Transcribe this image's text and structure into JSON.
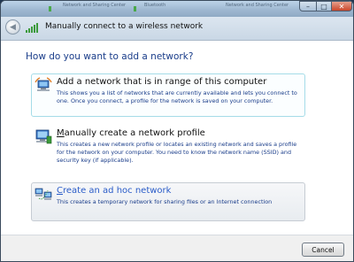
{
  "window": {
    "title": "Manually connect to a wireless network",
    "background_titles": [
      "Network and Sharing Center",
      "Bluetooth",
      "Network and Sharing Center"
    ]
  },
  "controls": {
    "minimize_glyph": "–",
    "maximize_glyph": "□",
    "close_glyph": "✕",
    "back_glyph": "◀"
  },
  "main": {
    "heading": "How do you want to add a network?",
    "options": [
      {
        "title": "Add a network that is in range of this computer",
        "description": "This shows you a list of networks that are currently available and lets you connect to one. Once you connect, a profile for the network is saved on your computer.",
        "icon": "wireless-network-icon"
      },
      {
        "title_mnemonic": "M",
        "title_rest": "anually create a network profile",
        "description": "This creates a new network profile or locates an existing network and saves a profile for the network on your computer. You need to know the network name (SSID) and security key (if applicable).",
        "icon": "network-computer-icon"
      },
      {
        "title_mnemonic": "C",
        "title_rest": "reate an ad hoc network",
        "description": "This creates a temporary network for sharing files or an Internet connection",
        "icon": "adhoc-network-icon"
      }
    ]
  },
  "footer": {
    "cancel_label": "Cancel"
  },
  "colors": {
    "heading": "#1a3d8a",
    "description": "#1a3d8a",
    "link": "#2a5cc8",
    "highlight_border": "#a5dce8",
    "close_button": "#c9462a"
  }
}
